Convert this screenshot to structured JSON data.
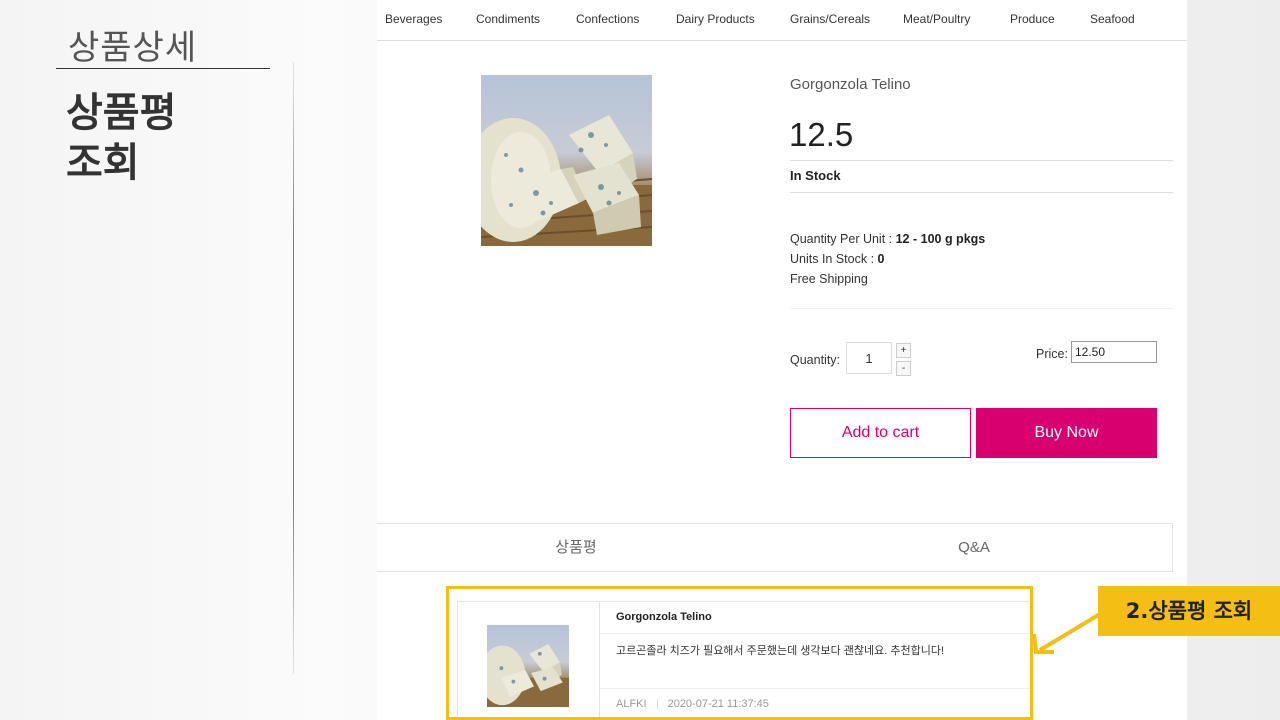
{
  "slide": {
    "section_title": "상품상세",
    "heading": "상품평\n조회"
  },
  "nav": {
    "categories": [
      "Beverages",
      "Condiments",
      "Confections",
      "Dairy Products",
      "Grains/Cereals",
      "Meat/Poultry",
      "Produce",
      "Seafood"
    ]
  },
  "product": {
    "name": "Gorgonzola Telino",
    "price": "12.5",
    "stock_status": "In Stock",
    "quantity_per_unit_label": "Quantity Per Unit : ",
    "quantity_per_unit": "12 - 100 g pkgs",
    "units_in_stock_label": "Units In Stock : ",
    "units_in_stock": "0",
    "shipping": "Free Shipping"
  },
  "order": {
    "quantity_label": "Quantity:",
    "quantity_value": "1",
    "plus": "+",
    "minus": "-",
    "price_label": "Price:",
    "price_value": "12.50",
    "add_to_cart": "Add to cart",
    "buy_now": "Buy Now"
  },
  "tabs": [
    "상품평",
    "Q&A"
  ],
  "review": {
    "title": "Gorgonzola Telino",
    "body": "고르곤졸라 치즈가 필요해서 주문했는데 생각보다 괜찮네요. 추천합니다!",
    "author": "ALFKI",
    "timestamp": "2020-07-21 11:37:45"
  },
  "annotation": {
    "label": "2.상품평 조회"
  },
  "colors": {
    "accent": "#d8006e",
    "highlight": "#f5be14"
  }
}
